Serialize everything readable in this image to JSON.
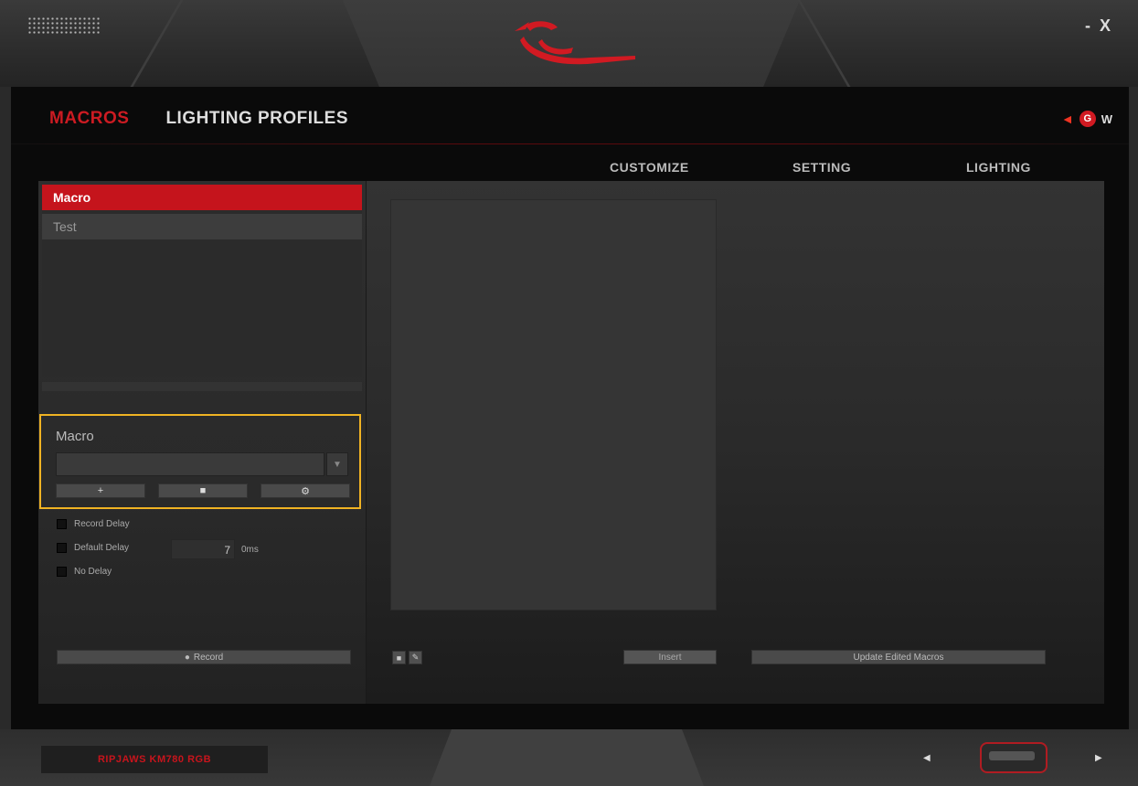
{
  "window": {
    "minimize_label": "-",
    "close_label": "X"
  },
  "nav": {
    "tabs": [
      {
        "label": "MACROS",
        "active": true
      },
      {
        "label": "LIGHTING PROFILES",
        "active": false
      }
    ],
    "mode": {
      "g_label": "G",
      "w_label": "W"
    }
  },
  "subnav": {
    "items": [
      "CUSTOMIZE",
      "SETTING",
      "LIGHTING"
    ]
  },
  "macro_list": {
    "items": [
      {
        "label": "Macro",
        "selected": true
      },
      {
        "label": "Test",
        "selected": false
      }
    ]
  },
  "macro_group": {
    "title": "Macro",
    "buttons": {
      "add": "+",
      "stop": "■",
      "settings": "⚙"
    }
  },
  "options": {
    "record_delay": "Record Delay",
    "default_delay": "Default Delay",
    "default_delay_value": "7",
    "default_delay_unit": "0ms",
    "no_delay": "No Delay",
    "record_label": "Record"
  },
  "editor": {
    "insert_label": "Insert",
    "update_label": "Update Edited Macros"
  },
  "footer": {
    "device_name": "RIPJAWS KM780 RGB"
  },
  "colors": {
    "accent_red": "#c5141c",
    "highlight_border": "#f0b323"
  }
}
